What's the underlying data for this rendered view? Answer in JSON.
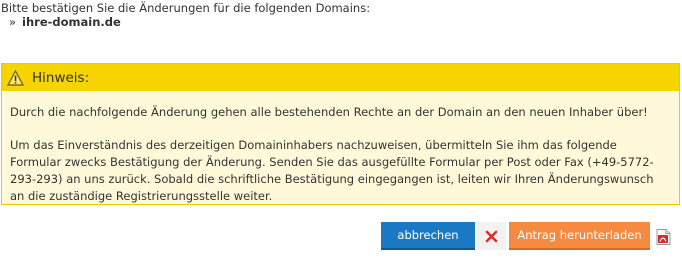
{
  "intro": {
    "text": "Bitte bestätigen Sie die Änderungen für die folgenden Domains:",
    "bullet": "»",
    "domain": "ihre-domain.de"
  },
  "notice": {
    "title": "Hinweis:",
    "icon": "warning-triangle-icon",
    "paragraph1": "Durch die nachfolgende Änderung gehen alle bestehenden Rechte an der Domain an den neuen Inhaber über!",
    "paragraph2": "Um das Einverständnis des derzeitigen Domaininhabers nachzuweisen, übermitteln Sie ihm das folgende Formular zwecks Bestätigung der Änderung. Senden Sie das ausgefüllte Formular per Post oder Fax (+49-5772-293-293) an uns zurück. Sobald die schriftliche Bestätigung eingegangen ist, leiten wir Ihren Änderungswunsch an die zuständige Registrierungsstelle weiter."
  },
  "actions": {
    "cancel_label": "abbrechen",
    "cancel_icon": "close-x-icon",
    "download_label": "Antrag herunterladen",
    "download_icon": "pdf-icon"
  },
  "colors": {
    "notice_header": "#f5d400",
    "notice_bg": "#fff8d9",
    "cancel_button": "#1b78c2",
    "download_button": "#f58a40",
    "close_x": "#d9302c"
  }
}
